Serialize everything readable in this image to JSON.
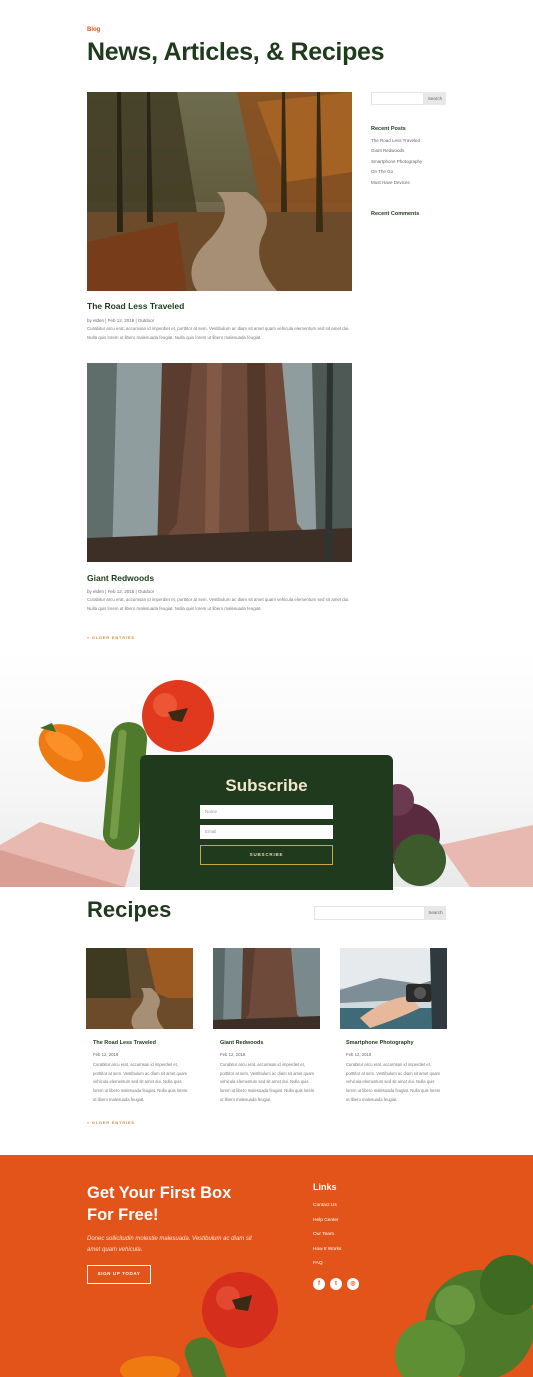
{
  "header": {
    "eyebrow": "Blog",
    "title": "News, Articles, & Recipes"
  },
  "posts": [
    {
      "title": "The Road Less Traveled",
      "author": "by elden",
      "date": "Feb 12, 2018",
      "category": "Outdoor",
      "excerpt": "Curabitur arcu erat, accumsan id imperdiet et, porttitor at sem. Vestibulum ac diam sit amet quam vehicula elementum sed sit amet dui. Nulla quis lorem ut libero malesuada feugiat. Nulla quis lorem ut libero malesuada feugiat."
    },
    {
      "title": "Giant Redwoods",
      "author": "by elden",
      "date": "Feb 12, 2018",
      "category": "Outdoor",
      "excerpt": "Curabitur arcu erat, accumsan id imperdiet et, porttitor at sem. Vestibulum ac diam sit amet quam vehicula elementum sed sit amet dui. Nulla quis lorem ut libero malesuada feugiat. Nulla quis lorem ut libero malesuada feugiat."
    }
  ],
  "older_entries": "« OLDER ENTRIES",
  "sidebar": {
    "search_button": "Search",
    "recent_posts_title": "Recent Posts",
    "recent_posts": [
      "The Road Less Traveled",
      "Giant Redwoods",
      "Smartphone Photography",
      "On The Go",
      "Must Have Devices"
    ],
    "recent_comments_title": "Recent Comments"
  },
  "subscribe": {
    "title": "Subscribe",
    "name_placeholder": "Name",
    "email_placeholder": "Email",
    "button": "SUBSCRIBE"
  },
  "recipes": {
    "title": "Recipes",
    "search_button": "Search",
    "cards": [
      {
        "title": "The Road Less Traveled",
        "date": "Feb 12, 2018",
        "excerpt": "Curabitur arcu erat, accumsan id imperdiet et, porttitor at sem. Vestibulum ac diam sit amet quam vehicula elementum sed sit amet dui. Nulla quis lorem ut libero malesuada feugiat. Nulla quis lorem ut libero malesuada feugiat."
      },
      {
        "title": "Giant Redwoods",
        "date": "Feb 12, 2018",
        "excerpt": "Curabitur arcu erat, accumsan id imperdiet et, porttitor at sem. Vestibulum ac diam sit amet quam vehicula elementum sed sit amet dui. Nulla quis lorem ut libero malesuada feugiat. Nulla quis lorem ut libero malesuada feugiat."
      },
      {
        "title": "Smartphone Photography",
        "date": "Feb 12, 2018",
        "excerpt": "Curabitur arcu erat, accumsan id imperdiet et, porttitor at sem. Vestibulum ac diam sit amet quam vehicula elementum sed sit amet dui. Nulla quis lorem ut libero malesuada feugiat. Nulla quis lorem ut libero malesuada feugiat."
      }
    ],
    "older_entries": "« OLDER ENTRIES"
  },
  "footer": {
    "title": "Get Your First Box For Free!",
    "subtitle": "Donec sollicitudin molestie malesuada. Vestibulum ac diam sit amet quam vehicula.",
    "button": "SIGN UP TODAY",
    "links_title": "Links",
    "links": [
      "Contact Us",
      "Help Center",
      "Our Team",
      "How It Works",
      "FAQ"
    ],
    "social": [
      {
        "icon": "facebook-icon",
        "glyph": "f"
      },
      {
        "icon": "twitter-icon",
        "glyph": "t"
      },
      {
        "icon": "instagram-icon",
        "glyph": "◎"
      }
    ]
  },
  "colors": {
    "brand_green": "#1f3a1d",
    "brand_orange": "#e2541a",
    "gold": "#c9a646"
  }
}
